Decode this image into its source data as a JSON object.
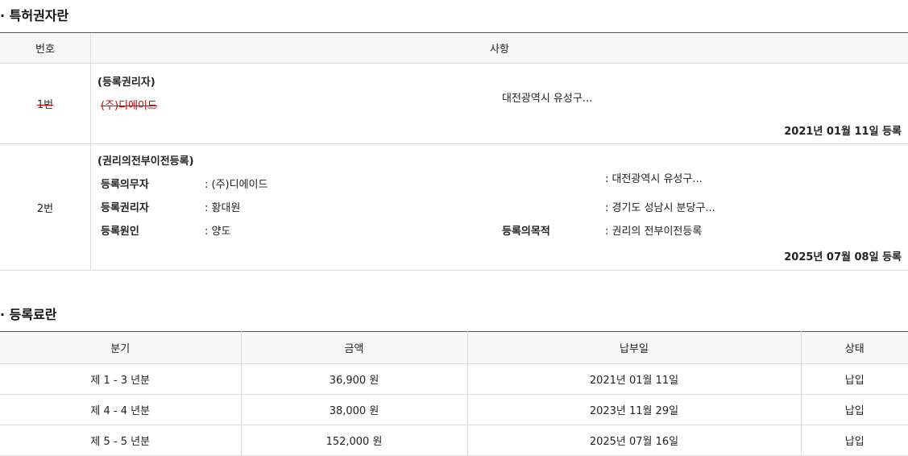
{
  "patent_owner_section": {
    "title": "· 특허권자란",
    "headers": {
      "number": "번호",
      "details": "사항"
    },
    "row1": {
      "number": "1번",
      "heading": "(등록권리자)",
      "name": "(주)디에이드",
      "address": "대전광역시 유성구...",
      "date": "2021년 01월 11일 등록"
    },
    "row2": {
      "number": "2번",
      "heading": "(권리의전부이전등록)",
      "obligor_label": "등록의무자",
      "obligor_value": ": (주)디에이드",
      "obligor_address": ": 대전광역시 유성구...",
      "holder_label": "등록권리자",
      "holder_value": ": 황대원",
      "holder_address": ": 경기도 성남시 분당구...",
      "cause_label": "등록원인",
      "cause_value": ": 양도",
      "purpose_label": "등록의목적",
      "purpose_value": ": 권리의 전부이전등록",
      "date": "2025년 07월 08일 등록"
    }
  },
  "fee_section": {
    "title": "· 등록료란",
    "headers": [
      "분기",
      "금액",
      "납부일",
      "상태"
    ],
    "rows": [
      {
        "period": "제 1 - 3 년분",
        "amount": "36,900 원",
        "paid_date": "2021년 01월 11일",
        "status": "납입"
      },
      {
        "period": "제 4 - 4 년분",
        "amount": "38,000 원",
        "paid_date": "2023년 11월 29일",
        "status": "납입"
      },
      {
        "period": "제 5 - 5 년분",
        "amount": "152,000 원",
        "paid_date": "2025년 07월 16일",
        "status": "납입"
      }
    ]
  }
}
